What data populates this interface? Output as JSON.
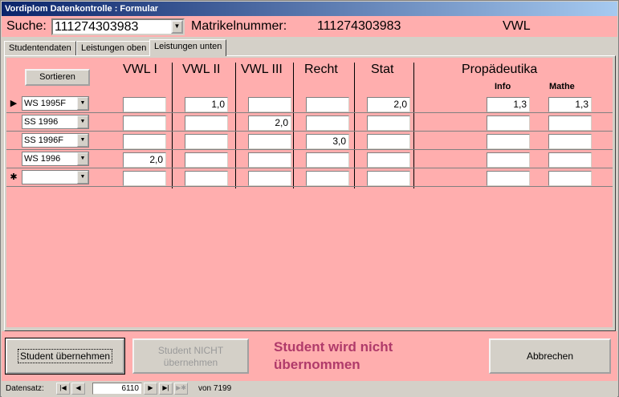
{
  "window": {
    "title": "Vordiplom Datenkontrolle : Formular"
  },
  "header": {
    "search_label": "Suche:",
    "search_value": "111274303983",
    "matrikel_label": "Matrikelnummer:",
    "matrikel_value": "111274303983",
    "fach": "VWL"
  },
  "tabs": [
    {
      "label": "Studentendaten",
      "active": false
    },
    {
      "label": "Leistungen oben",
      "active": false
    },
    {
      "label": "Leistungen unten",
      "active": true
    }
  ],
  "grid": {
    "sort_label": "Sortieren",
    "columns": [
      "VWL I",
      "VWL II",
      "VWL III",
      "Recht",
      "Stat",
      "Propädeutika"
    ],
    "subcolumns": [
      "Info",
      "Mathe"
    ],
    "rows": [
      {
        "selector": "▶",
        "semester": "WS 1995F",
        "values": [
          "",
          "1,0",
          "",
          "",
          "2,0",
          "1,3",
          "1,3"
        ]
      },
      {
        "selector": "",
        "semester": "SS 1996",
        "values": [
          "",
          "",
          "2,0",
          "",
          "",
          "",
          ""
        ]
      },
      {
        "selector": "",
        "semester": "SS 1996F",
        "values": [
          "",
          "",
          "",
          "3,0",
          "",
          "",
          ""
        ]
      },
      {
        "selector": "",
        "semester": "WS 1996",
        "values": [
          "2,0",
          "",
          "",
          "",
          "",
          "",
          ""
        ]
      },
      {
        "selector": "✱",
        "semester": "",
        "values": [
          "",
          "",
          "",
          "",
          "",
          "",
          ""
        ]
      }
    ]
  },
  "footer": {
    "accept_label": "Student übernehmen",
    "reject_line1": "Student NICHT",
    "reject_line2": "übernehmen",
    "status_line1": "Student wird nicht",
    "status_line2": "übernommen",
    "cancel_label": "Abbrechen",
    "status_color": "#b03a6a"
  },
  "nav": {
    "label": "Datensatz:",
    "current": "6110",
    "of_label": "von",
    "total": "7199",
    "icons": [
      "first-record-icon",
      "prev-record-icon",
      "next-record-icon",
      "last-record-icon",
      "new-record-icon"
    ]
  },
  "colors": {
    "form_background": "#ffaeae",
    "window_chrome": "#d4d0c8",
    "title_bar": "#0a246a"
  }
}
